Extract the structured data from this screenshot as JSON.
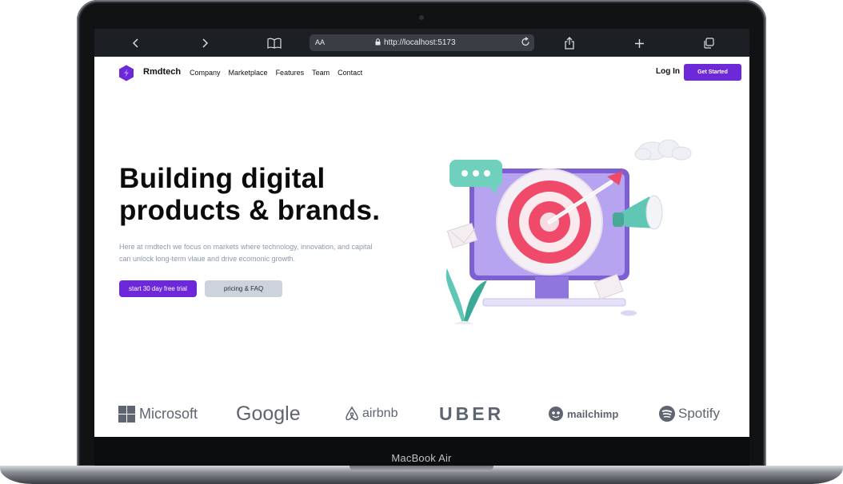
{
  "device": {
    "model": "MacBook Air"
  },
  "browser": {
    "text_size_label": "AA",
    "url": "http://localhost:5173"
  },
  "site": {
    "brand": "Rmdtech",
    "nav": [
      "Company",
      "Marketplace",
      "Features",
      "Team",
      "Contact"
    ],
    "login_label": "Log In",
    "cta_label": "Get Started",
    "accent": "#6d28d9"
  },
  "hero": {
    "title_line1": "Building digital",
    "title_line2": "products & brands.",
    "subtitle_line1": "Here at rmdtech we focus on markets where technology, innovation, and capital",
    "subtitle_line2": "can unlock long-term vlaue and drive ecomonic growth.",
    "primary_label": "start 30 day free trial",
    "secondary_label": "pricing & FAQ"
  },
  "partners": [
    "Microsoft",
    "Google",
    "airbnb",
    "UBER",
    "mailchimp",
    "Spotify"
  ]
}
